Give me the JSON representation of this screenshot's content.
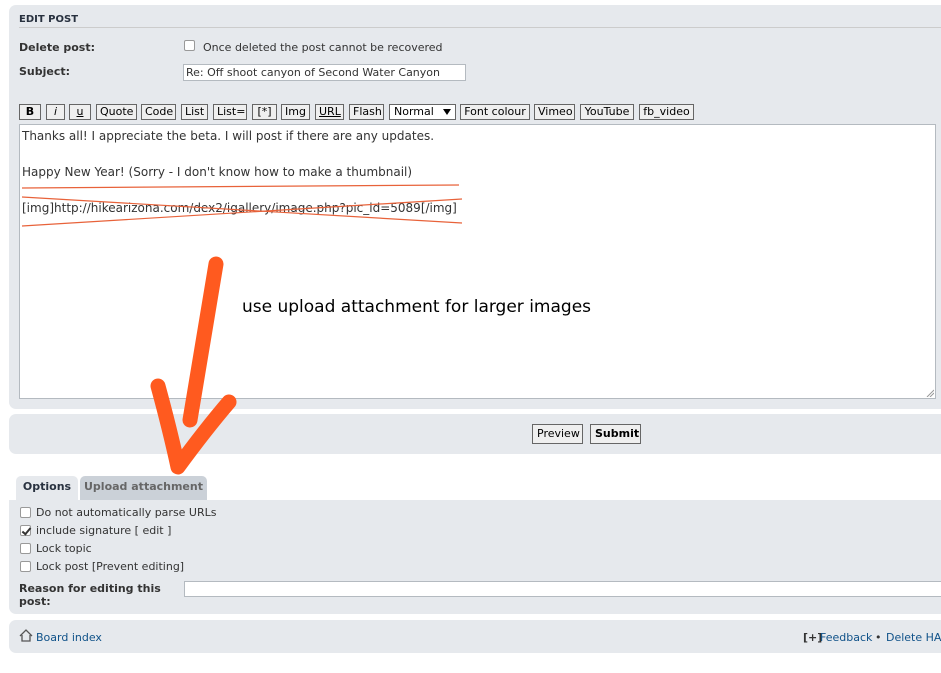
{
  "header": {
    "title": "EDIT POST"
  },
  "delete_post": {
    "label": "Delete post:",
    "checkbox_text": "Once deleted the post cannot be recovered",
    "checked": false
  },
  "subject": {
    "label": "Subject:",
    "value": "Re: Off shoot canyon of Second Water Canyon"
  },
  "toolbar": {
    "bold": "B",
    "italic": "i",
    "underline": "u",
    "quote": "Quote",
    "code": "Code",
    "list": "List",
    "list_ordered": "List=",
    "list_item": "[*]",
    "img": "Img",
    "url": "URL",
    "flash": "Flash",
    "font_size": "Normal",
    "font_colour": "Font colour",
    "vimeo": "Vimeo",
    "youtube": "YouTube",
    "fb_video": "fb_video"
  },
  "editor": {
    "lines": [
      "Thanks all!  I appreciate the beta. I will post if there are any updates.",
      "",
      "Happy New Year! (Sorry - I don't know how to make a thumbnail)",
      "",
      "[img]http://hikearizona.com/dex2/igallery/image.php?pic_id=5089[/img]"
    ]
  },
  "annotation": {
    "note": "use upload attachment for larger images",
    "arrow_color": "#ff5a1f",
    "strike_color": "#e8623a"
  },
  "actions": {
    "preview": "Preview",
    "submit": "Submit"
  },
  "tabs": [
    {
      "label": "Options",
      "active": true
    },
    {
      "label": "Upload attachment",
      "active": false
    }
  ],
  "options": [
    {
      "label": "Do not automatically parse URLs",
      "checked": false
    },
    {
      "label": "include signature [ edit ]",
      "checked": true
    },
    {
      "label": "Lock topic",
      "checked": false
    },
    {
      "label": "Lock post [Prevent editing]",
      "checked": false
    }
  ],
  "reason": {
    "label_line1": "Reason for editing this",
    "label_line2": "post:",
    "value": ""
  },
  "footer": {
    "board_index": "Board index",
    "feedback_prefix": "[+]",
    "feedback": "Feedback",
    "separator": "•",
    "delete": "Delete HA"
  }
}
